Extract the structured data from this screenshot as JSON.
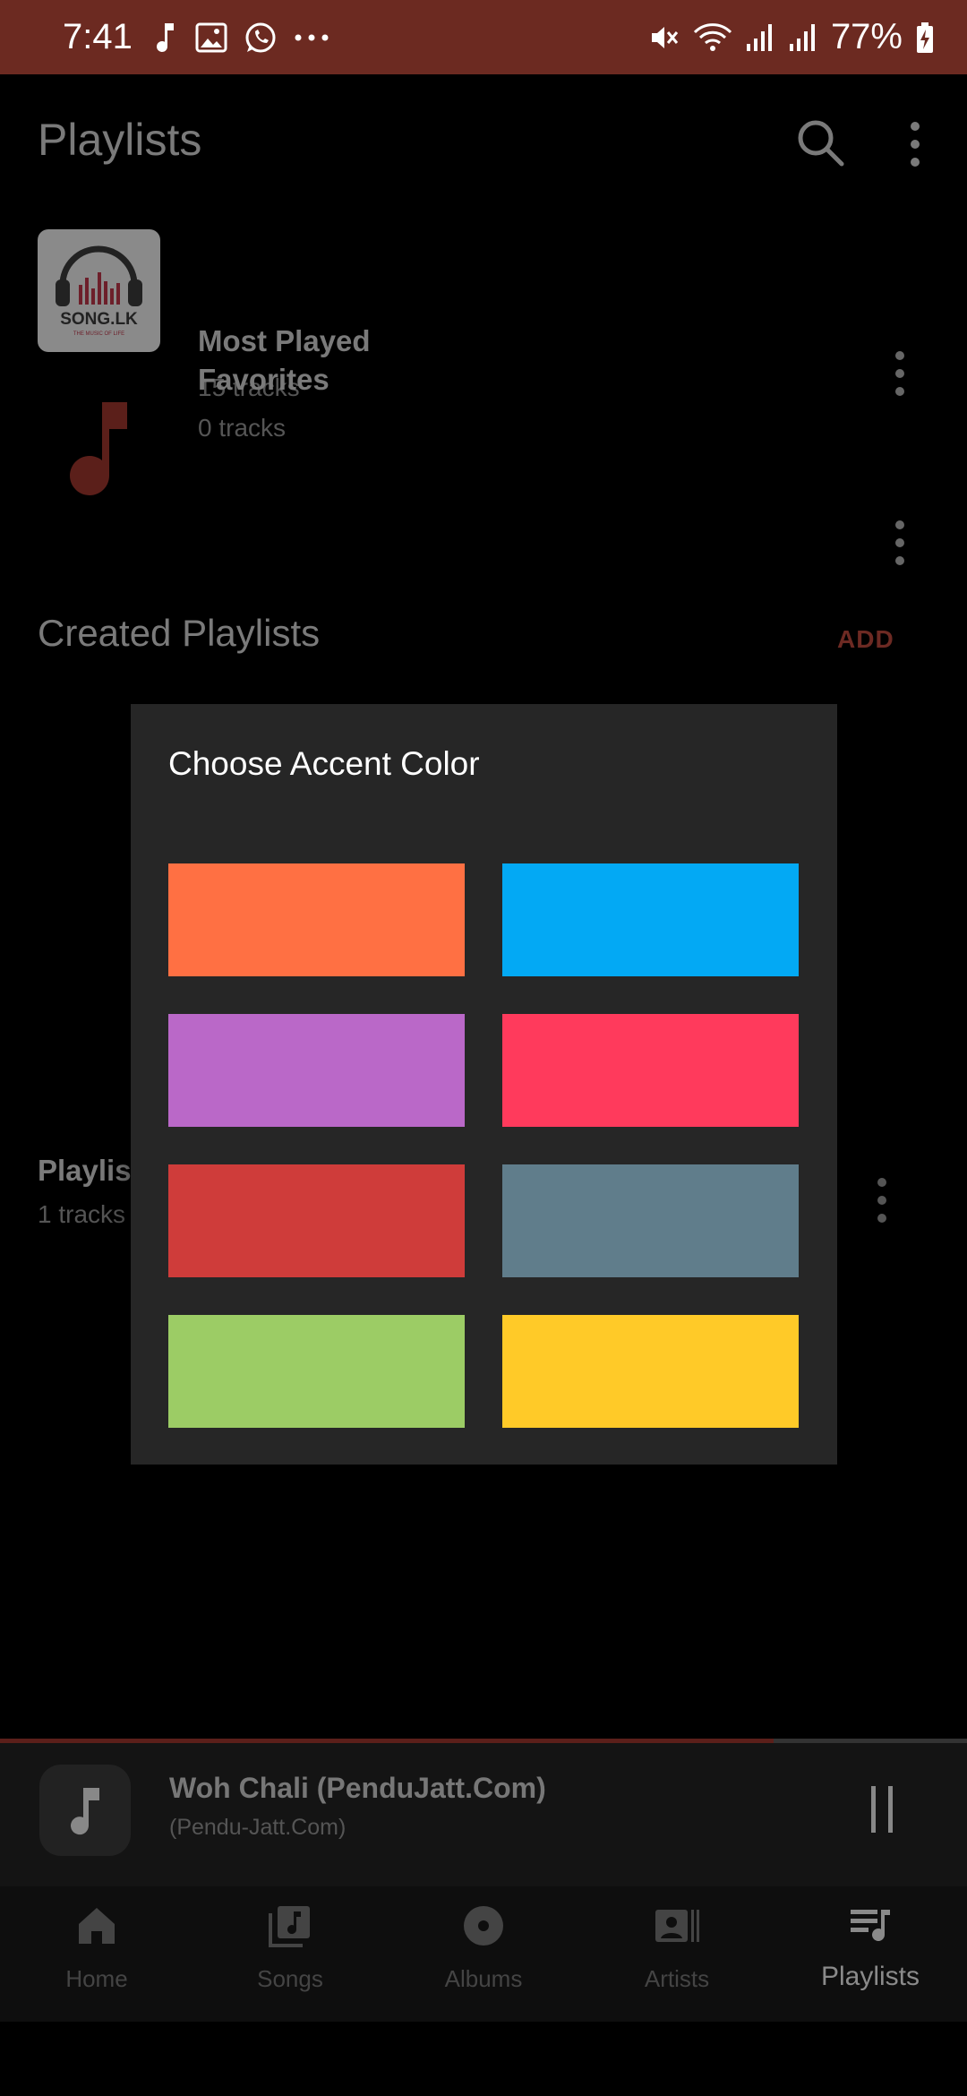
{
  "status_bar": {
    "time": "7:41",
    "battery": "77%",
    "icons_left": [
      "music-note-icon",
      "image-icon",
      "whatsapp-icon",
      "more-dots-icon"
    ],
    "icons_right": [
      "mute-icon",
      "wifi-icon",
      "signal-icon",
      "signal-icon",
      "battery-charging-icon"
    ]
  },
  "header": {
    "title": "Playlists"
  },
  "playlists": [
    {
      "title": "Most Played",
      "subtitle": "15 tracks",
      "thumb_text": "SONG.LK",
      "thumb_subtext": "THE MUSIC OF LIFE"
    },
    {
      "title": "Favorites",
      "subtitle": "0 tracks"
    }
  ],
  "created": {
    "title": "Created Playlists",
    "add_label": "ADD"
  },
  "created_item": {
    "title": "Playlis",
    "subtitle": "1 tracks"
  },
  "dialog": {
    "title": "Choose Accent Color",
    "swatches": [
      "#FF7043",
      "#03A9F4",
      "#BA68C8",
      "#FF3A5C",
      "#CF3C3A",
      "#607D8B",
      "#9CCC65",
      "#FFCA28"
    ]
  },
  "mini_player": {
    "title": "Woh Chali (PenduJatt.Com)",
    "artist": "(Pendu-Jatt.Com)",
    "progress": 0.8
  },
  "bottom_nav": [
    {
      "label": "Home",
      "icon": "home-icon"
    },
    {
      "label": "Songs",
      "icon": "songs-icon"
    },
    {
      "label": "Albums",
      "icon": "album-icon"
    },
    {
      "label": "Artists",
      "icon": "artists-icon"
    },
    {
      "label": "Playlists",
      "icon": "playlists-icon",
      "active": true
    }
  ],
  "colors": {
    "status_bar": "#6c2a21",
    "accent_dim": "#6d2a23"
  }
}
